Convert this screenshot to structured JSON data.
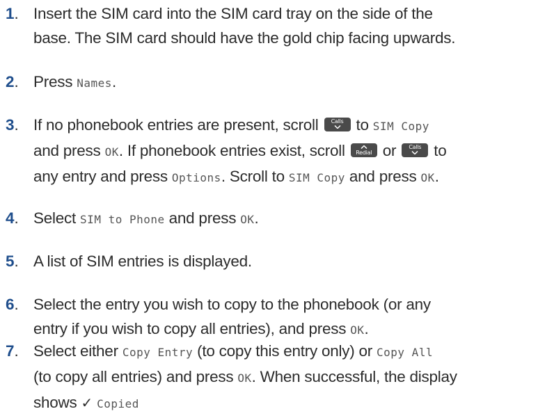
{
  "steps": [
    {
      "num": "1",
      "line1": "Insert the SIM card into the SIM card tray on the side of the",
      "line2": "base. The SIM card should have the gold chip facing upwards."
    },
    {
      "num": "2",
      "pre": "Press ",
      "lcd": "Names",
      "post": "."
    },
    {
      "num": "3",
      "a": "If no phonebook entries are present, scroll ",
      "b": " to ",
      "c": "SIM Copy",
      "d": "and press ",
      "e": "OK",
      "f": ". If phonebook entries exist, scroll ",
      "g": " or ",
      "h": " to",
      "i": "any entry and press ",
      "j": "Options",
      "k": ". Scroll to ",
      "l": "SIM Copy",
      "m": " and press ",
      "n": "OK",
      "o": "."
    },
    {
      "num": "4",
      "a": "Select ",
      "b": "SIM to Phone",
      "c": " and press ",
      "d": "OK",
      "e": "."
    },
    {
      "num": "5",
      "a": "A list of SIM entries is displayed."
    },
    {
      "num": "6",
      "line1": "Select the entry you wish to copy to the phonebook (or any",
      "a": "entry if you wish to copy all entries), and press ",
      "b": "OK",
      "c": "."
    },
    {
      "num": "7",
      "a": "Select either ",
      "b": "Copy Entry",
      "c": " (to copy this entry only) or ",
      "d": "Copy All",
      "e": "(to copy all entries) and press ",
      "f": "OK",
      "g": ". When successful, the display",
      "h": "shows ",
      "check": "✓",
      "i": "Copied"
    }
  ],
  "keys": {
    "calls_label": "Calls",
    "redial_label": "Redial"
  },
  "colors": {
    "number": "#1f4e8c",
    "key_bg": "#4a4a4a",
    "text": "#2b2b2b"
  }
}
